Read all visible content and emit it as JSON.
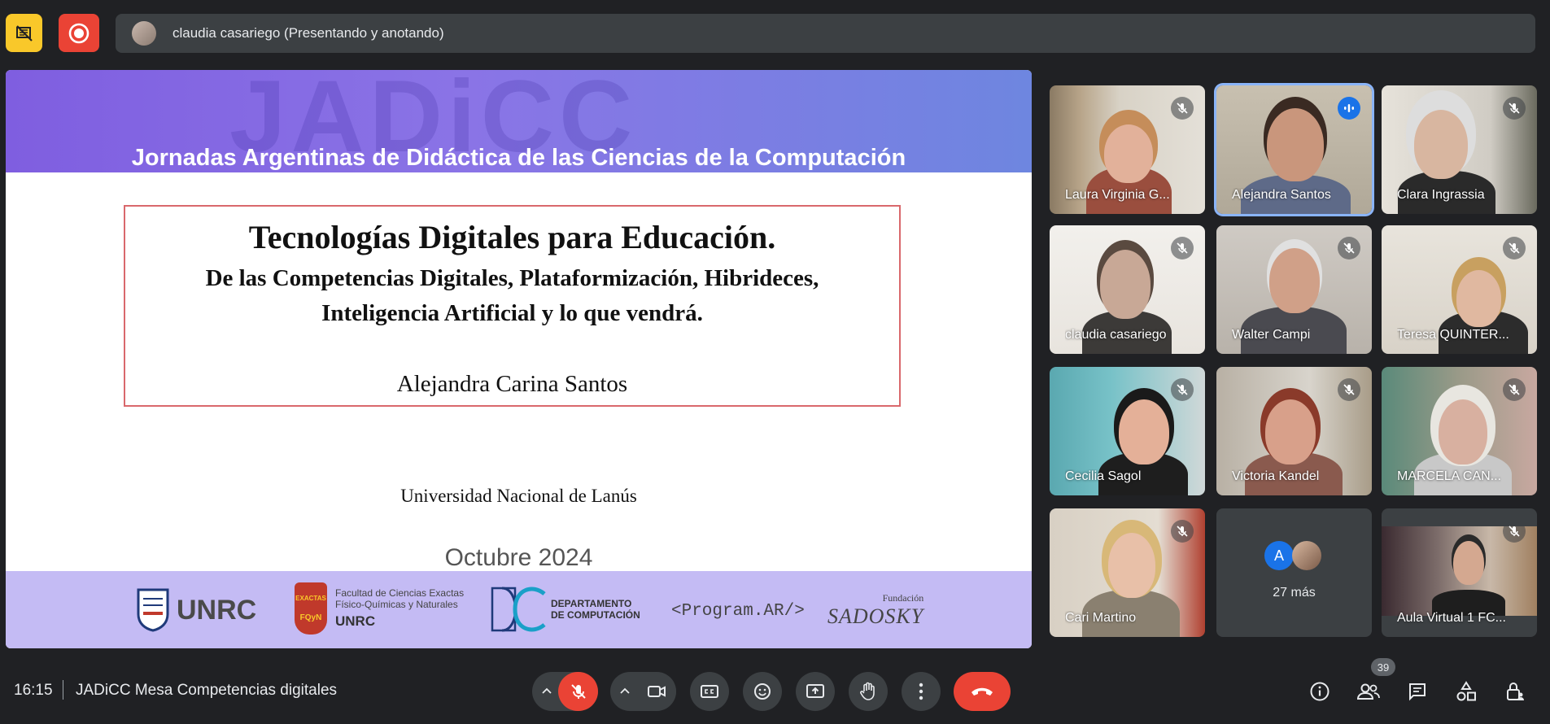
{
  "top_bar": {
    "presenter_text": "claudia casariego (Presentando y anotando)"
  },
  "slide": {
    "watermark": "JADiCC",
    "heading": "Jornadas Argentinas de Didáctica de las Ciencias de la Computación",
    "title": "Tecnologías Digitales para Educación.",
    "subtitle_line1": "De las Competencias Digitales, Plataformización, Hibrideces,",
    "subtitle_line2": "Inteligencia Artificial y lo que vendrá.",
    "author": "Alejandra Carina Santos",
    "university": "Universidad Nacional de Lanús",
    "date": "Octubre 2024",
    "footer_logos": {
      "unrc": "UNRC",
      "exactas_badge_top": "EXACTAS",
      "exactas_badge_bottom": "FQyN",
      "exactas_line1": "Facultad de Ciencias Exactas",
      "exactas_line2": "Físico-Químicas y Naturales",
      "exactas_line3": "UNRC",
      "dc_line1": "DEPARTAMENTO",
      "dc_line2": "DE COMPUTACIÓN",
      "programar": "<Program.AR/>",
      "fundacion": "Fundación",
      "sadosky": "SADOSKY"
    }
  },
  "participants": [
    {
      "name": "Laura Virginia G...",
      "muted": true
    },
    {
      "name": "Alejandra Santos",
      "muted": false,
      "speaking": true
    },
    {
      "name": "Clara Ingrassia",
      "muted": true
    },
    {
      "name": "claudia casariego",
      "muted": true
    },
    {
      "name": "Walter Campi",
      "muted": true
    },
    {
      "name": "Teresa QUINTER...",
      "muted": true
    },
    {
      "name": "Cecilia Sagol",
      "muted": true
    },
    {
      "name": "Victoria Kandel",
      "muted": true
    },
    {
      "name": "MARCELA CAN...",
      "muted": true
    },
    {
      "name": "Cari Martino",
      "muted": true
    },
    {
      "name": "Aula Virtual 1 FC...",
      "muted": true
    }
  ],
  "more_tile": {
    "avatar_letter": "A",
    "label": "27 más"
  },
  "bottom_bar": {
    "time": "16:15",
    "meeting_title": "JADiCC Mesa Competencias digitales",
    "people_count": "39"
  },
  "colors": {
    "accent_blue": "#8ab4f8",
    "end_call": "#ea4335",
    "record": "#ea4335",
    "warning": "#f9c82a"
  }
}
